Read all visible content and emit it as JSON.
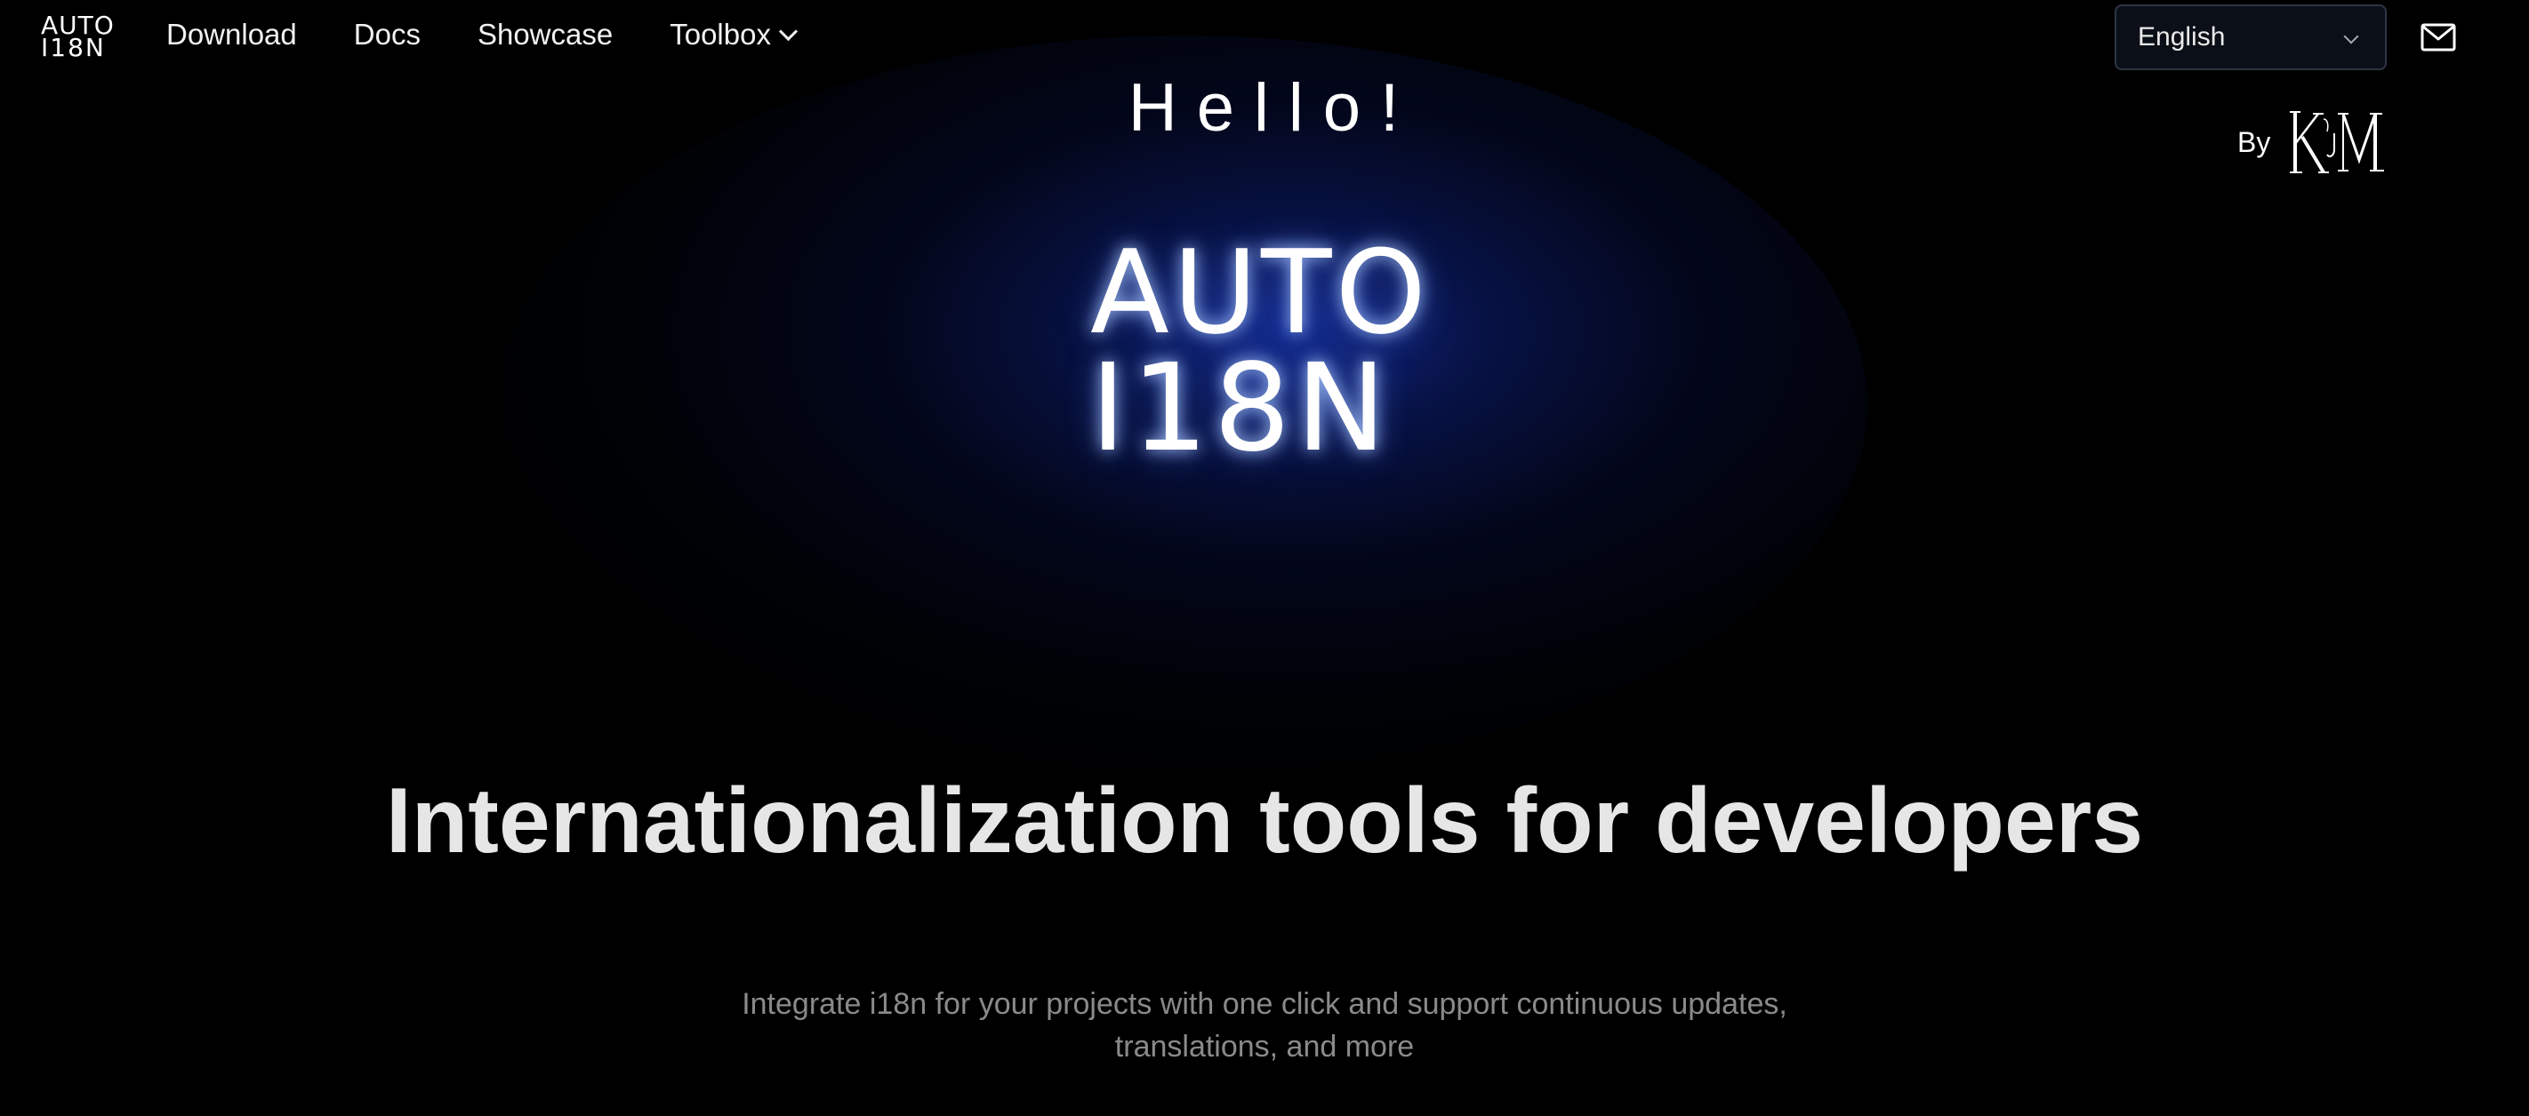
{
  "nav": {
    "logo_line1": "AUTO",
    "logo_line2": "I18N",
    "links": [
      {
        "label": "Download"
      },
      {
        "label": "Docs"
      },
      {
        "label": "Showcase"
      },
      {
        "label": "Toolbox",
        "icon": "chevron-down-icon"
      }
    ],
    "language": {
      "selected": "English",
      "icon": "chevron-down-icon"
    },
    "mail_icon": "mail-icon"
  },
  "hero": {
    "greeting": "Hello!",
    "by_label": "By",
    "brand_line1": "AUTO",
    "brand_line2": "I18N",
    "headline": "Internationalization tools for developers",
    "subtitle": "Integrate i18n for your projects with one click and support continuous updates, translations, and more"
  },
  "colors": {
    "background": "#000000",
    "glow": "#142d96",
    "headline": "#e6e6e6",
    "subtitle": "#8a8a8a",
    "select_border": "#2e3644"
  }
}
